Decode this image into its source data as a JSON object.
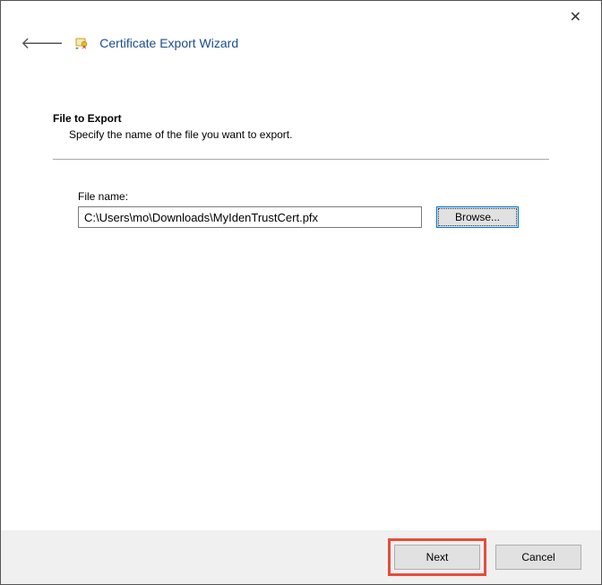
{
  "titlebar": {
    "close_label": "✕"
  },
  "header": {
    "back_label": "🡐",
    "wizard_title": "Certificate Export Wizard"
  },
  "content": {
    "section_title": "File to Export",
    "section_desc": "Specify the name of the file you want to export.",
    "file_label": "File name:",
    "file_value": "C:\\Users\\mo\\Downloads\\MyIdenTrustCert.pfx",
    "browse_label": "Browse..."
  },
  "footer": {
    "next_label": "Next",
    "cancel_label": "Cancel"
  }
}
